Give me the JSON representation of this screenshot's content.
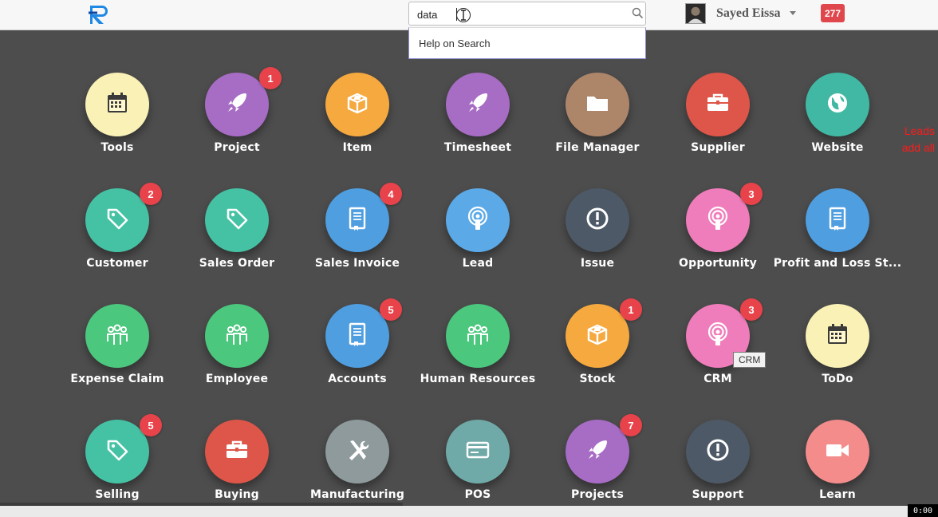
{
  "header": {
    "search_value": "data",
    "search_suggestion": "Help on Search",
    "user_name": "Sayed Eissa",
    "notification_count": "277"
  },
  "side_notes": [
    "Leads",
    "add all"
  ],
  "tooltip": "CRM",
  "timer": "0:00",
  "apps": [
    {
      "label": "Tools",
      "icon": "calendar-icon",
      "color": "#f9f1b6",
      "badge": ""
    },
    {
      "label": "Project",
      "icon": "rocket-icon",
      "color": "#a76cc4",
      "badge": "1"
    },
    {
      "label": "Item",
      "icon": "box-icon",
      "color": "#f5a93f",
      "badge": ""
    },
    {
      "label": "Timesheet",
      "icon": "rocket-icon",
      "color": "#a76cc4",
      "badge": ""
    },
    {
      "label": "File Manager",
      "icon": "folder-icon",
      "color": "#ad866a",
      "badge": ""
    },
    {
      "label": "Supplier",
      "icon": "briefcase-icon",
      "color": "#dd5649",
      "badge": ""
    },
    {
      "label": "Website",
      "icon": "globe-icon",
      "color": "#41b8a3",
      "badge": ""
    },
    {
      "label": "Customer",
      "icon": "tag-icon",
      "color": "#45c2a4",
      "badge": "2"
    },
    {
      "label": "Sales Order",
      "icon": "tag-icon",
      "color": "#45c2a4",
      "badge": ""
    },
    {
      "label": "Sales Invoice",
      "icon": "book-icon",
      "color": "#4f9ee0",
      "badge": "4"
    },
    {
      "label": "Lead",
      "icon": "broadcast-icon",
      "color": "#5ba9e7",
      "badge": ""
    },
    {
      "label": "Issue",
      "icon": "alert-icon",
      "color": "#4d5966",
      "badge": ""
    },
    {
      "label": "Opportunity",
      "icon": "broadcast-icon",
      "color": "#f07dbb",
      "badge": "3"
    },
    {
      "label": "Profit and Loss St...",
      "icon": "book-icon",
      "color": "#4f9ee0",
      "badge": ""
    },
    {
      "label": "Expense Claim",
      "icon": "team-icon",
      "color": "#4bc77e",
      "badge": ""
    },
    {
      "label": "Employee",
      "icon": "team-icon",
      "color": "#4bc77e",
      "badge": ""
    },
    {
      "label": "Accounts",
      "icon": "book-icon",
      "color": "#4f9ee0",
      "badge": "5"
    },
    {
      "label": "Human Resources",
      "icon": "team-icon",
      "color": "#4bc77e",
      "badge": ""
    },
    {
      "label": "Stock",
      "icon": "box-icon",
      "color": "#f5a93f",
      "badge": "1"
    },
    {
      "label": "CRM",
      "icon": "broadcast-icon",
      "color": "#f07dbb",
      "badge": "3"
    },
    {
      "label": "ToDo",
      "icon": "calendar-icon",
      "color": "#f9f1b6",
      "badge": ""
    },
    {
      "label": "Selling",
      "icon": "tag-icon",
      "color": "#45c2a4",
      "badge": "5"
    },
    {
      "label": "Buying",
      "icon": "briefcase-icon",
      "color": "#dd5649",
      "badge": ""
    },
    {
      "label": "Manufacturing",
      "icon": "tools-icon",
      "color": "#8e9a9c",
      "badge": ""
    },
    {
      "label": "POS",
      "icon": "card-icon",
      "color": "#6faaa8",
      "badge": ""
    },
    {
      "label": "Projects",
      "icon": "rocket-icon",
      "color": "#a76cc4",
      "badge": "7"
    },
    {
      "label": "Support",
      "icon": "alert-icon",
      "color": "#4d5966",
      "badge": ""
    },
    {
      "label": "Learn",
      "icon": "video-icon",
      "color": "#f48c8c",
      "badge": ""
    }
  ]
}
